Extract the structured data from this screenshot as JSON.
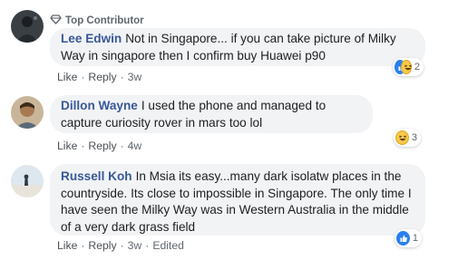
{
  "comments": [
    {
      "badge": "Top Contributor",
      "author": "Lee Edwin",
      "text": "Not in Singapore... if you can take picture of Milky Way in singapore then I confirm buy Huawei p90",
      "actions": {
        "like": "Like",
        "reply": "Reply",
        "time": "3w"
      },
      "reactions": {
        "types": [
          "like",
          "haha"
        ],
        "count": "2"
      }
    },
    {
      "author": "Dillon Wayne",
      "text": "I used the phone and managed to capture curiosity rover in mars too lol",
      "actions": {
        "like": "Like",
        "reply": "Reply",
        "time": "4w"
      },
      "reactions": {
        "types": [
          "haha"
        ],
        "count": "3"
      }
    },
    {
      "author": "Russell Koh",
      "text": "In Msia its easy...many dark isolatw places in the countryside. Its close to impossible in Singapore. The only time I have seen the Milky Way was in Western Australia in the middle of a very dark grass field",
      "actions": {
        "like": "Like",
        "reply": "Reply",
        "time": "3w",
        "edited": "Edited"
      },
      "reactions": {
        "types": [
          "like"
        ],
        "count": "1"
      }
    }
  ],
  "colors": {
    "author": "#385898",
    "bubble": "#f2f3f5",
    "like": "#2a80f0",
    "haha": "#f7c84a"
  }
}
